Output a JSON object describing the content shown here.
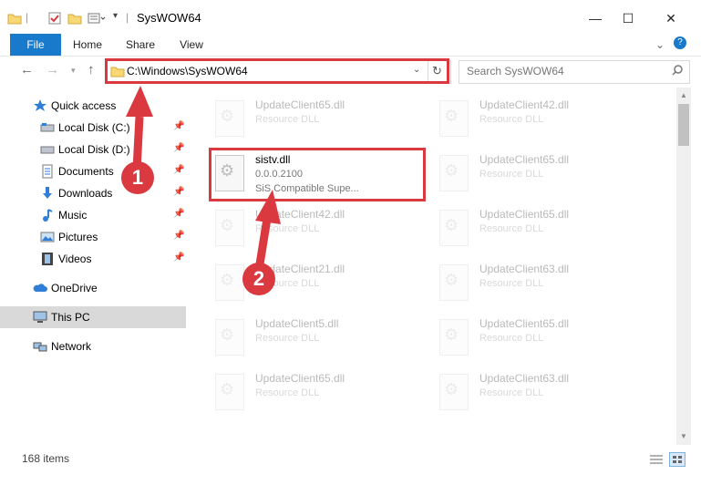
{
  "window": {
    "title": "SysWOW64",
    "minimize": "—",
    "maximize": "☐",
    "close": "✕"
  },
  "ribbon": {
    "tabs": [
      "File",
      "Home",
      "Share",
      "View"
    ],
    "help": "?",
    "expand": "⌄"
  },
  "address": {
    "path": "C:\\Windows\\SysWOW64",
    "search_placeholder": "Search SysWOW64"
  },
  "sidebar": {
    "items": [
      {
        "label": "Quick access"
      },
      {
        "label": "Local Disk (C:)"
      },
      {
        "label": "Local Disk (D:)"
      },
      {
        "label": "Documents"
      },
      {
        "label": "Downloads"
      },
      {
        "label": "Music"
      },
      {
        "label": "Pictures"
      },
      {
        "label": "Videos"
      },
      {
        "label": "OneDrive"
      },
      {
        "label": "This PC"
      },
      {
        "label": "Network"
      }
    ]
  },
  "files": {
    "left": [
      {
        "name": "UpdateClient65.dll",
        "line2": "Resource DLL"
      },
      {
        "name": "sistv.dll",
        "line2": "0.0.0.2100",
        "line3": "SiS Compatible Supe..."
      },
      {
        "name": "UpdateClient42.dll",
        "line2": "Resource DLL"
      },
      {
        "name": "UpdateClient21.dll",
        "line2": "Resource DLL"
      },
      {
        "name": "UpdateClient5.dll",
        "line2": "Resource DLL"
      },
      {
        "name": "UpdateClient65.dll",
        "line2": "Resource DLL"
      }
    ],
    "right": [
      {
        "name": "UpdateClient42.dll",
        "line2": "Resource DLL"
      },
      {
        "name": "UpdateClient65.dll",
        "line2": "Resource DLL"
      },
      {
        "name": "UpdateClient65.dll",
        "line2": "Resource DLL"
      },
      {
        "name": "UpdateClient63.dll",
        "line2": "Resource DLL"
      },
      {
        "name": "UpdateClient65.dll",
        "line2": "Resource DLL"
      },
      {
        "name": "UpdateClient63.dll",
        "line2": "Resource DLL"
      }
    ]
  },
  "status": {
    "count": "168 items"
  },
  "annotations": {
    "step1": "1",
    "step2": "2"
  },
  "colors": {
    "accent": "#1979ca",
    "annotation": "#d9393f"
  }
}
